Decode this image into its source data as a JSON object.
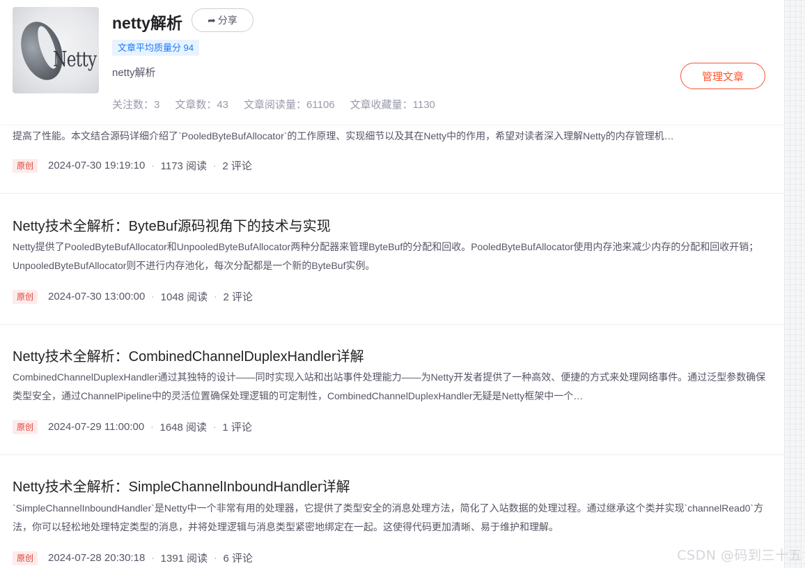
{
  "column": {
    "cover_text": "Netty",
    "title": "netty解析",
    "share_label": "分享",
    "quality_badge": "文章平均质量分 94",
    "description": "netty解析",
    "stats": {
      "followers": "关注数：3",
      "articles": "文章数：43",
      "reads": "文章阅读量：61106",
      "favorites": "文章收藏量：1130"
    },
    "manage_label": "管理文章"
  },
  "partial_article": {
    "description": "提高了性能。本文结合源码详细介绍了`PooledByteBufAllocator`的工作原理、实现细节以及其在Netty中的作用，希望对读者深入理解Netty的内存管理机…",
    "tag": "原创",
    "date": "2024-07-30 19:19:10",
    "reads": "1173 阅读",
    "comments": "2 评论"
  },
  "articles": [
    {
      "title": "Netty技术全解析：ByteBuf源码视角下的技术与实现",
      "description": "Netty提供了PooledByteBufAllocator和UnpooledByteBufAllocator两种分配器来管理ByteBuf的分配和回收。PooledByteBufAllocator使用内存池来减少内存的分配和回收开销；UnpooledByteBufAllocator则不进行内存池化，每次分配都是一个新的ByteBuf实例。",
      "tag": "原创",
      "date": "2024-07-30 13:00:00",
      "reads": "1048 阅读",
      "comments": "2 评论"
    },
    {
      "title": "Netty技术全解析：CombinedChannelDuplexHandler详解",
      "description": "CombinedChannelDuplexHandler通过其独特的设计——同时实现入站和出站事件处理能力——为Netty开发者提供了一种高效、便捷的方式来处理网络事件。通过泛型参数确保类型安全，通过ChannelPipeline中的灵活位置确保处理逻辑的可定制性，CombinedChannelDuplexHandler无疑是Netty框架中一个…",
      "tag": "原创",
      "date": "2024-07-29 11:00:00",
      "reads": "1648 阅读",
      "comments": "1 评论"
    },
    {
      "title": "Netty技术全解析：SimpleChannelInboundHandler详解",
      "description": "`SimpleChannelInboundHandler`是Netty中一个非常有用的处理器，它提供了类型安全的消息处理方法，简化了入站数据的处理过程。通过继承这个类并实现`channelRead0`方法，你可以轻松地处理特定类型的消息，并将处理逻辑与消息类型紧密地绑定在一起。这使得代码更加清晰、易于维护和理解。",
      "tag": "原创",
      "date": "2024-07-28 20:30:18",
      "reads": "1391 阅读",
      "comments": "6 评论"
    }
  ],
  "watermark": "CSDN @码到三十五"
}
